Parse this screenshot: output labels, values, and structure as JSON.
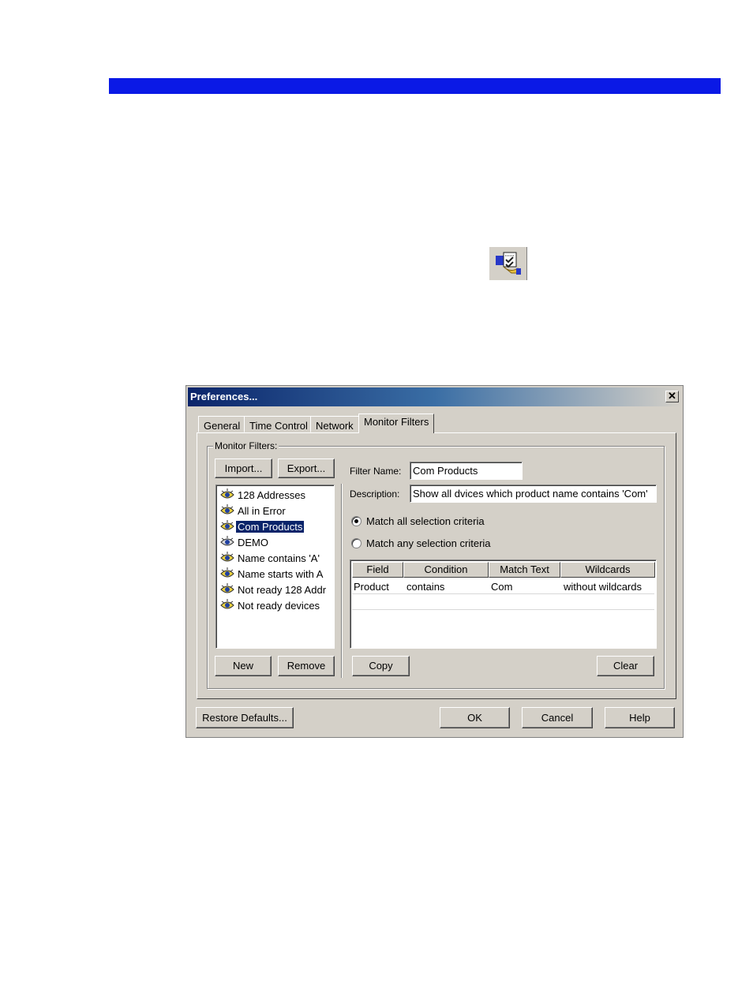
{
  "dialog": {
    "title": "Preferences...",
    "close_glyph": "✕",
    "tabs": [
      {
        "label": "General"
      },
      {
        "label": "Time Control"
      },
      {
        "label": "Network"
      },
      {
        "label": "Monitor Filters"
      }
    ],
    "group_label": "Monitor Filters:",
    "import_label": "Import...",
    "export_label": "Export...",
    "filters": [
      {
        "label": "128 Addresses"
      },
      {
        "label": "All in Error"
      },
      {
        "label": "Com Products"
      },
      {
        "label": "DEMO"
      },
      {
        "label": "Name contains 'A'"
      },
      {
        "label": "Name starts with A"
      },
      {
        "label": "Not ready 128 Addr"
      },
      {
        "label": "Not ready devices"
      }
    ],
    "selected_filter": "Com Products",
    "new_label": "New",
    "remove_label": "Remove",
    "filter_name_label": "Filter Name:",
    "filter_name_value": "Com Products",
    "description_label": "Description:",
    "description_value": "Show all dvices which product name contains 'Com'",
    "match_all_label": "Match all selection criteria",
    "match_any_label": "Match any selection criteria",
    "match_mode": "all",
    "grid": {
      "columns": [
        "Field",
        "Condition",
        "Match Text",
        "Wildcards"
      ],
      "rows": [
        [
          "Product",
          "contains",
          "Com",
          "without wildcards"
        ]
      ]
    },
    "copy_label": "Copy",
    "clear_label": "Clear",
    "restore_label": "Restore Defaults...",
    "ok_label": "OK",
    "cancel_label": "Cancel",
    "help_label": "Help"
  },
  "icons": {
    "toolbar": "preferences-checklist-icon",
    "filter_item": "eye-icon"
  },
  "colors": {
    "header_bar": "#0a19e6",
    "titlebar_start": "#0a246a",
    "dialog_face": "#d4d0c8",
    "selection": "#0a246a"
  }
}
